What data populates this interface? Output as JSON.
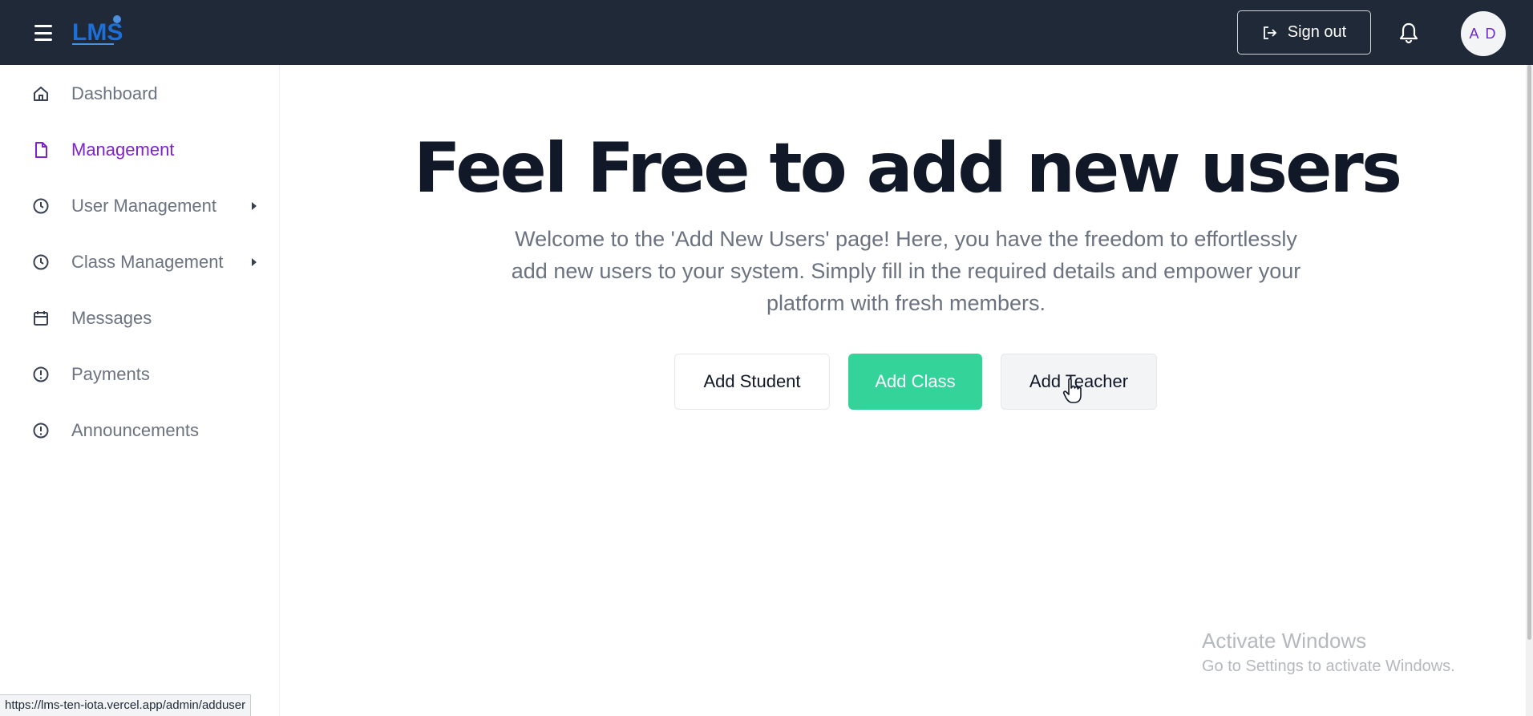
{
  "header": {
    "logo_text": "LMS",
    "signout_label": "Sign out",
    "avatar_initials": "A D"
  },
  "sidebar": {
    "items": [
      {
        "label": "Dashboard",
        "icon": "home-icon",
        "active": false,
        "has_submenu": false
      },
      {
        "label": "Management",
        "icon": "document-icon",
        "active": true,
        "has_submenu": false
      },
      {
        "label": "User Management",
        "icon": "clock-icon",
        "active": false,
        "has_submenu": true
      },
      {
        "label": "Class Management",
        "icon": "clock-icon",
        "active": false,
        "has_submenu": true
      },
      {
        "label": "Messages",
        "icon": "calendar-icon",
        "active": false,
        "has_submenu": false
      },
      {
        "label": "Payments",
        "icon": "alert-circle-icon",
        "active": false,
        "has_submenu": false
      },
      {
        "label": "Announcements",
        "icon": "alert-circle-icon",
        "active": false,
        "has_submenu": false
      }
    ]
  },
  "main": {
    "headline": "Feel Free to add new users",
    "intro": "Welcome to the 'Add New Users' page! Here, you have the freedom to effortlessly add new users to your system. Simply fill in the required details and empower your platform with fresh members.",
    "buttons": {
      "add_student": "Add Student",
      "add_class": "Add Class",
      "add_teacher": "Add Teacher"
    }
  },
  "watermark": {
    "line1": "Activate Windows",
    "line2": "Go to Settings to activate Windows."
  },
  "status_bar": {
    "url": "https://lms-ten-iota.vercel.app/admin/adduser"
  },
  "colors": {
    "topbar": "#1f2937",
    "active_nav": "#7e22ce",
    "add_class_green": "#34d399",
    "avatar_text": "#6d28d9"
  }
}
